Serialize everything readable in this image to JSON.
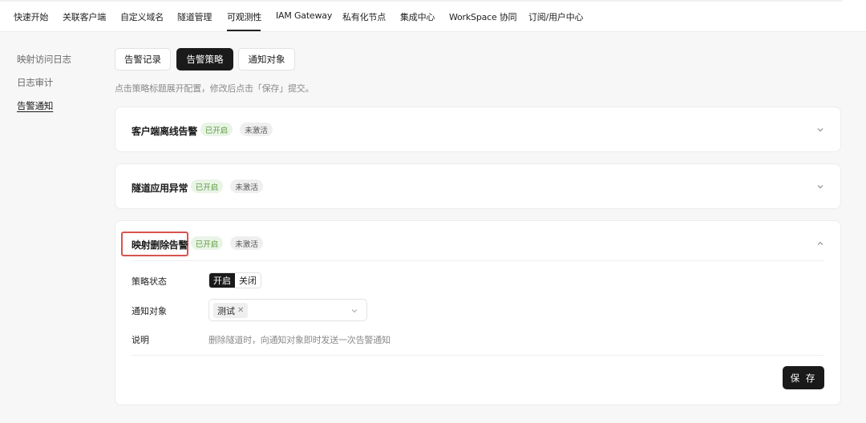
{
  "nav": {
    "items": [
      {
        "label": "快速开始"
      },
      {
        "label": "关联客户端"
      },
      {
        "label": "自定义域名"
      },
      {
        "label": "隧道管理"
      },
      {
        "label": "可观测性"
      },
      {
        "label": "IAM Gateway"
      },
      {
        "label": "私有化节点"
      },
      {
        "label": "集成中心"
      },
      {
        "label": "WorkSpace 协同"
      },
      {
        "label": "订阅/用户中心"
      }
    ],
    "active": "可观测性"
  },
  "sidebar": {
    "items": [
      {
        "label": "映射访问日志"
      },
      {
        "label": "日志审计"
      },
      {
        "label": "告警通知"
      }
    ],
    "active": "告警通知"
  },
  "tabs": {
    "items": [
      {
        "label": "告警记录"
      },
      {
        "label": "告警策略"
      },
      {
        "label": "通知对象"
      }
    ],
    "active": "告警策略"
  },
  "hint": "点击策略标题展开配置，修改后点击「保存」提交。",
  "policies": [
    {
      "title": "客户端离线告警",
      "enabled_badge": "已开启",
      "active_badge": "未激活",
      "expanded": false
    },
    {
      "title": "隧道应用异常",
      "enabled_badge": "已开启",
      "active_badge": "未激活",
      "expanded": false
    },
    {
      "title": "映射删除告警",
      "enabled_badge": "已开启",
      "active_badge": "未激活",
      "expanded": true,
      "form": {
        "status_label": "策略状态",
        "status_on": "开启",
        "status_off": "关闭",
        "status_value": "开启",
        "target_label": "通知对象",
        "target_tags": [
          "测试"
        ],
        "desc_label": "说明",
        "desc_value": "删除隧道时，向通知对象即时发送一次告警通知",
        "save_label": "保 存"
      }
    }
  ],
  "colors": {
    "accent": "#1a1a1a",
    "badge_on_bg": "#e9f4e6",
    "badge_on_text": "#5a9a3e",
    "highlight": "#d9534f"
  }
}
